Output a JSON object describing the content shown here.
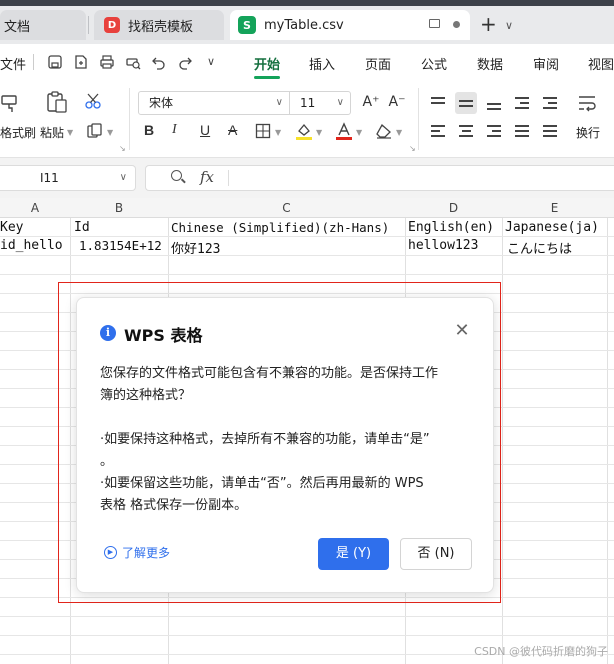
{
  "tabs": {
    "doc": "文档",
    "template": "找稻壳模板",
    "active_file": "myTable.csv",
    "template_icon_letter": "D",
    "file_icon_letter": "S"
  },
  "menu": {
    "file": "文件",
    "tabs": [
      "开始",
      "插入",
      "页面",
      "公式",
      "数据",
      "审阅",
      "视图"
    ],
    "active_tab": "开始"
  },
  "ribbon": {
    "format_painter": "格式刷",
    "paste": "粘贴",
    "font_name": "宋体",
    "font_size": "11",
    "wrap": "换行",
    "bold": "B",
    "italic": "I",
    "underline": "U",
    "strike": "A",
    "font_grow": "A⁺",
    "font_shrink": "A⁻"
  },
  "formula_bar": {
    "cell_ref": "I11",
    "fx": "fx",
    "value": ""
  },
  "sheet": {
    "columns": [
      "A",
      "B",
      "C",
      "D",
      "E"
    ],
    "row1": [
      "Key",
      "Id",
      "Chinese (Simplified)(zh-Hans)",
      "English(en)",
      "Japanese(ja)"
    ],
    "row2": [
      "id_hello",
      "1.83154E+12",
      "你好123",
      "hellow123",
      "こんにちは"
    ]
  },
  "dialog": {
    "title": "WPS 表格",
    "line1a": "您保存的文件格式可能包含有不兼容的功能。是否保持工作",
    "line1b": "簿的这种格式？",
    "line2a": "·如要保持这种格式，去掉所有不兼容的功能，请单击“是”",
    "line2b": "。",
    "line3a": "·如要保留这些功能，请单击“否”。然后再用最新的 WPS",
    "line3b": "表格 格式保存一份副本。",
    "learn_more": "了解更多",
    "yes_button": "是 (Y)",
    "no_button": "否 (N)"
  },
  "watermark": "CSDN @彼代码折磨的狗子",
  "colors": {
    "accent_green": "#14a35a",
    "primary_blue": "#2f6fec",
    "highlight_red": "#e1251b"
  }
}
